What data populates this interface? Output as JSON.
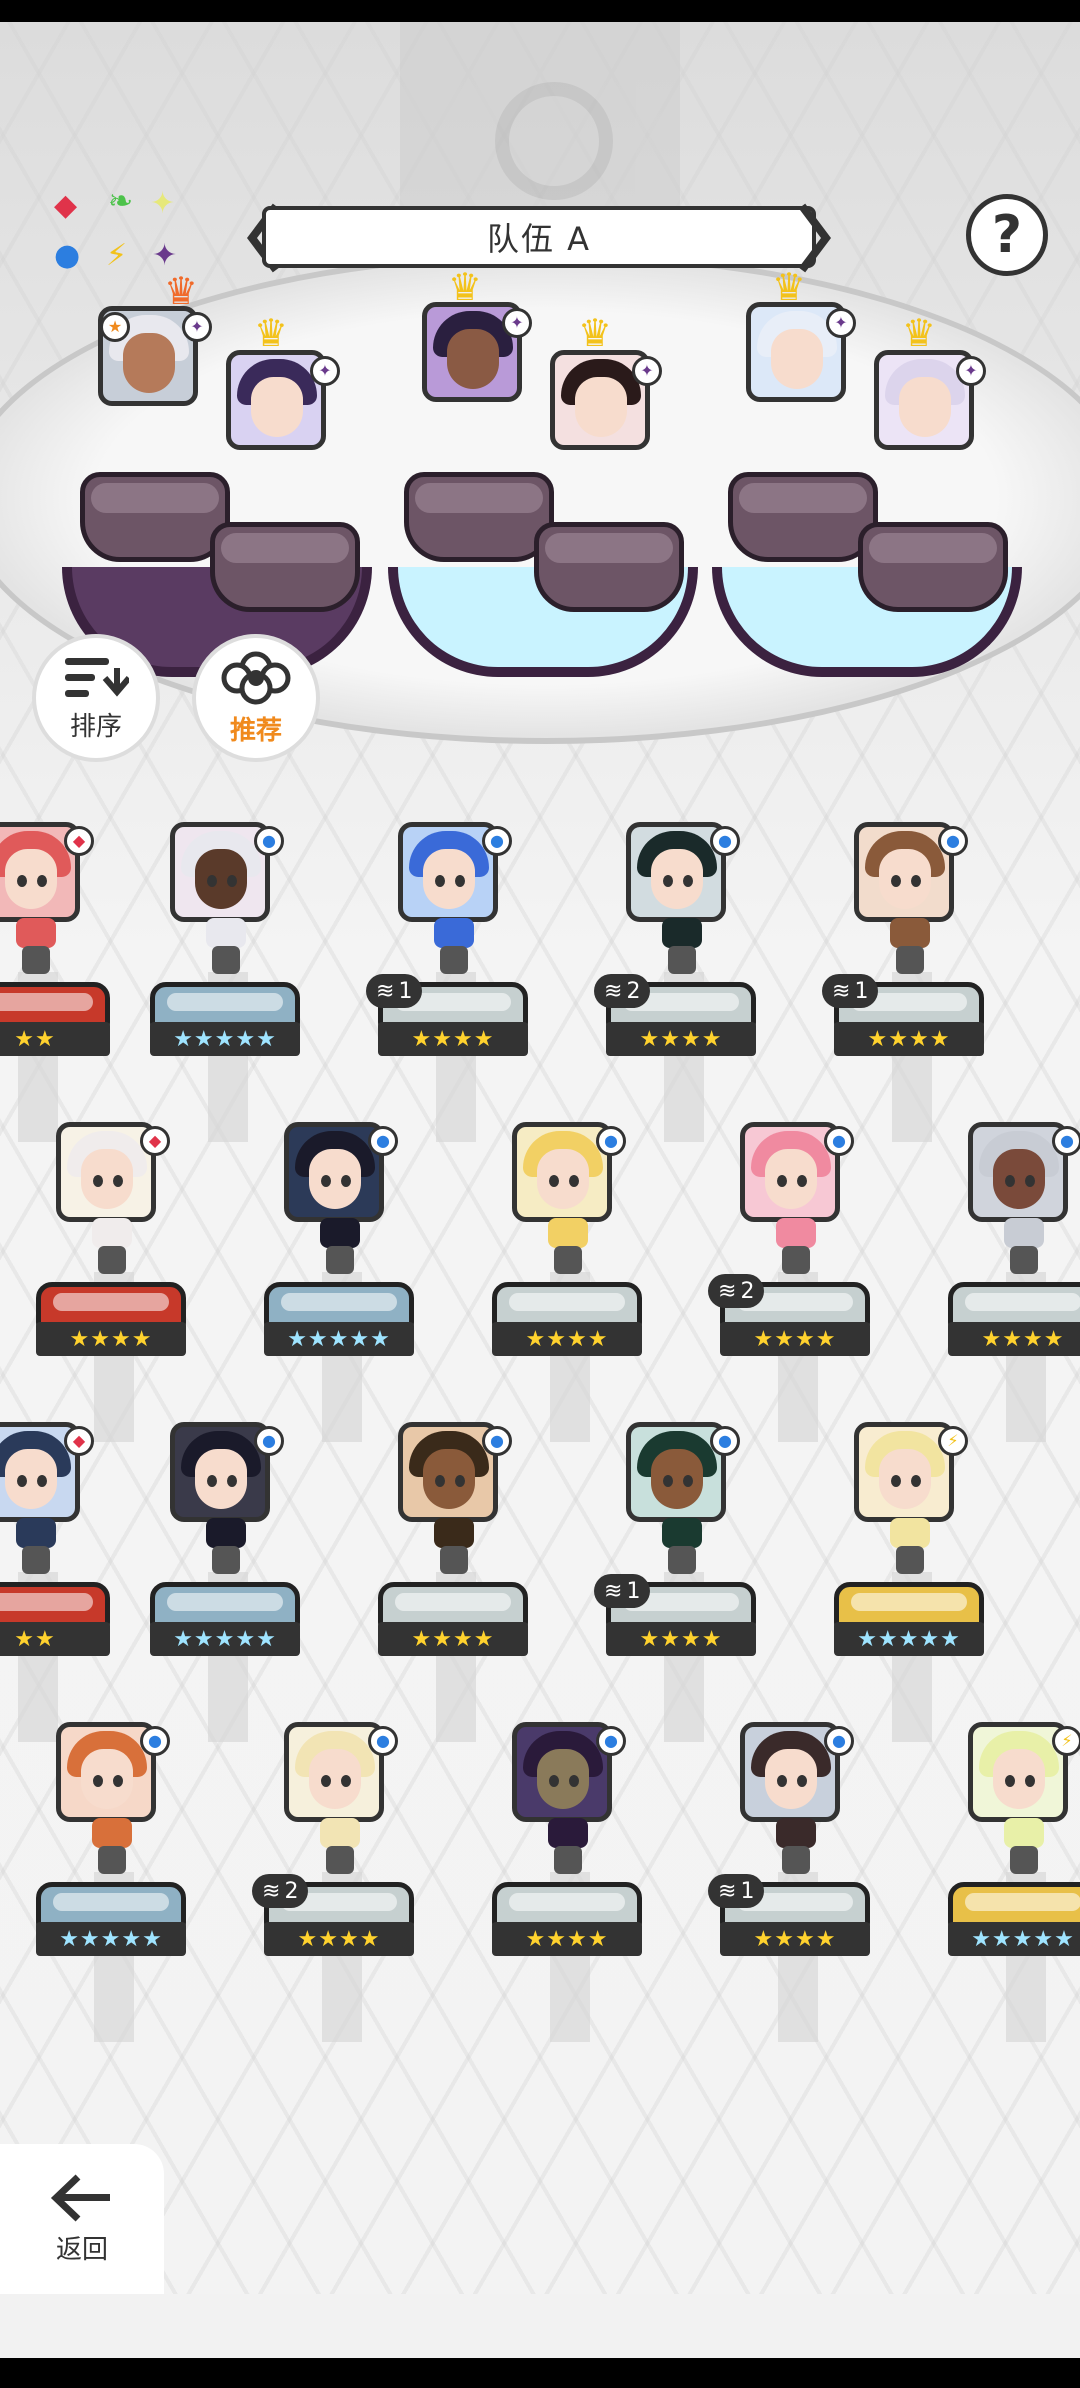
{
  "team": {
    "title": "队伍 A"
  },
  "help": {
    "label": "?"
  },
  "sort_button": {
    "label": "排序"
  },
  "recommend_button": {
    "label": "推荐"
  },
  "back_button": {
    "label": "返回"
  },
  "element_icons": [
    "fire-diamond-icon",
    "leaf-icon",
    "light-star-icon",
    "water-orb-icon",
    "lightning-icon",
    "dark-star-icon"
  ],
  "colors": {
    "accent_orange": "#f08a1d",
    "crown_gold": "#f3c21b",
    "star_yellow": "#ffd22e",
    "star_blue": "#9fe4ff"
  },
  "team_slots": [
    {
      "element": "dark-star-icon",
      "crown": true,
      "flame": true
    },
    {
      "element": "dark-star-icon",
      "crown": true
    },
    {
      "element": "dark-star-icon",
      "crown": true
    },
    {
      "element": "dark-star-icon",
      "crown": true
    },
    {
      "element": "dark-star-icon",
      "crown": true
    },
    {
      "element": "dark-star-icon",
      "crown": true
    }
  ],
  "roster": [
    {
      "row": 1,
      "stars": "★★",
      "dup": ""
    },
    {
      "row": 1,
      "stars": "★★★★★",
      "dup": ""
    },
    {
      "row": 1,
      "stars": "★★★★",
      "dup": "1"
    },
    {
      "row": 1,
      "stars": "★★★★",
      "dup": "2"
    },
    {
      "row": 1,
      "stars": "★★★★",
      "dup": "1"
    },
    {
      "row": 2,
      "stars": "★★★★",
      "dup": ""
    },
    {
      "row": 2,
      "stars": "★★★★★",
      "dup": ""
    },
    {
      "row": 2,
      "stars": "★★★★",
      "dup": ""
    },
    {
      "row": 2,
      "stars": "★★★★",
      "dup": "2"
    },
    {
      "row": 2,
      "stars": "★★★★",
      "dup": ""
    },
    {
      "row": 3,
      "stars": "★★",
      "dup": ""
    },
    {
      "row": 3,
      "stars": "★★★★★",
      "dup": ""
    },
    {
      "row": 3,
      "stars": "★★★★",
      "dup": ""
    },
    {
      "row": 3,
      "stars": "★★★★",
      "dup": "1"
    },
    {
      "row": 3,
      "stars": "★★★★★",
      "dup": ""
    },
    {
      "row": 4,
      "stars": "★★★★★",
      "dup": ""
    },
    {
      "row": 4,
      "stars": "★★★★",
      "dup": "2"
    },
    {
      "row": 4,
      "stars": "★★★★",
      "dup": ""
    },
    {
      "row": 4,
      "stars": "★★★★",
      "dup": "1"
    },
    {
      "row": 4,
      "stars": "★★★★★",
      "dup": ""
    }
  ]
}
